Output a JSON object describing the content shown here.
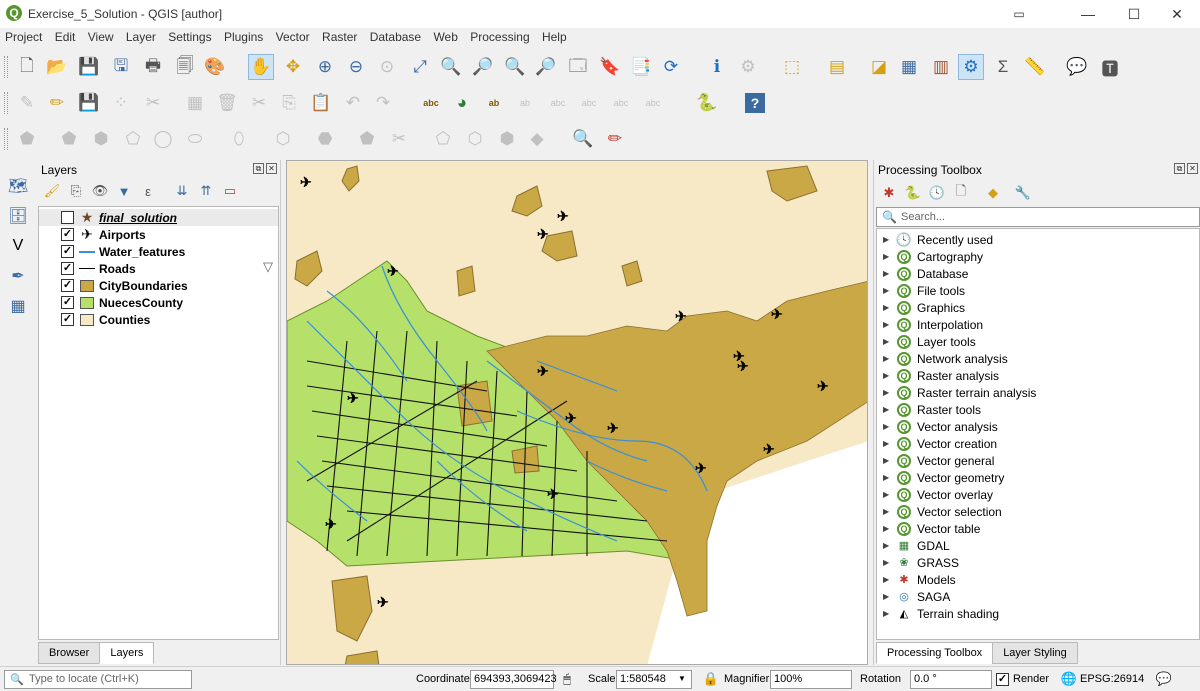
{
  "window": {
    "title": "Exercise_5_Solution - QGIS [author]",
    "app_icon": "Q",
    "minimize": "—",
    "maximize": "☐",
    "close": "✕",
    "restore_icon": "▭"
  },
  "menu": [
    "Project",
    "Edit",
    "View",
    "Layer",
    "Settings",
    "Plugins",
    "Vector",
    "Raster",
    "Database",
    "Web",
    "Processing",
    "Help"
  ],
  "layers_panel": {
    "title": "Layers",
    "layers": [
      {
        "name": "final_solution",
        "checked": false,
        "symbol": "star",
        "italic_underline": true
      },
      {
        "name": "Airports",
        "checked": true,
        "symbol": "plus"
      },
      {
        "name": "Water_features",
        "checked": true,
        "symbol": "blue-line"
      },
      {
        "name": "Roads",
        "checked": true,
        "symbol": "black-line"
      },
      {
        "name": "CityBoundaries",
        "checked": true,
        "symbol": "fill",
        "color": "#c9a845"
      },
      {
        "name": "NuecesCounty",
        "checked": true,
        "symbol": "fill",
        "color": "#b5e06a"
      },
      {
        "name": "Counties",
        "checked": true,
        "symbol": "fill",
        "color": "#f7e8c6"
      }
    ],
    "tabs": [
      "Browser",
      "Layers"
    ],
    "active_tab": "Layers"
  },
  "processing_toolbox": {
    "title": "Processing Toolbox",
    "search_placeholder": "Search...",
    "items": [
      {
        "label": "Recently used",
        "icon": "clock-icon"
      },
      {
        "label": "Cartography",
        "icon": "qgis-icon"
      },
      {
        "label": "Database",
        "icon": "qgis-icon"
      },
      {
        "label": "File tools",
        "icon": "qgis-icon"
      },
      {
        "label": "Graphics",
        "icon": "qgis-icon"
      },
      {
        "label": "Interpolation",
        "icon": "qgis-icon"
      },
      {
        "label": "Layer tools",
        "icon": "qgis-icon"
      },
      {
        "label": "Network analysis",
        "icon": "qgis-icon"
      },
      {
        "label": "Raster analysis",
        "icon": "qgis-icon"
      },
      {
        "label": "Raster terrain analysis",
        "icon": "qgis-icon"
      },
      {
        "label": "Raster tools",
        "icon": "qgis-icon"
      },
      {
        "label": "Vector analysis",
        "icon": "qgis-icon"
      },
      {
        "label": "Vector creation",
        "icon": "qgis-icon"
      },
      {
        "label": "Vector general",
        "icon": "qgis-icon"
      },
      {
        "label": "Vector geometry",
        "icon": "qgis-icon"
      },
      {
        "label": "Vector overlay",
        "icon": "qgis-icon"
      },
      {
        "label": "Vector selection",
        "icon": "qgis-icon"
      },
      {
        "label": "Vector table",
        "icon": "qgis-icon"
      },
      {
        "label": "GDAL",
        "icon": "gdal-icon"
      },
      {
        "label": "GRASS",
        "icon": "grass-icon"
      },
      {
        "label": "Models",
        "icon": "models-icon"
      },
      {
        "label": "SAGA",
        "icon": "saga-icon"
      },
      {
        "label": "Terrain shading",
        "icon": "terrain-icon"
      }
    ],
    "tabs": [
      "Processing Toolbox",
      "Layer Styling"
    ],
    "active_tab": "Processing Toolbox"
  },
  "statusbar": {
    "locate_placeholder": "Type to locate (Ctrl+K)",
    "coordinate_label": "Coordinate",
    "coordinate_value": "694393,3069423",
    "scale_label": "Scale",
    "scale_value": "1:580548",
    "magnifier_label": "Magnifier",
    "magnifier_value": "100%",
    "rotation_label": "Rotation",
    "rotation_value": "0.0 °",
    "render_label": "Render",
    "render_checked": true,
    "crs": "EPSG:26914"
  },
  "colors": {
    "counties": "#f7e8c6",
    "nueces": "#b5e06a",
    "city": "#c9a845",
    "water": "#3a8fd6",
    "roads": "#000000",
    "qgis_green": "#589632"
  }
}
